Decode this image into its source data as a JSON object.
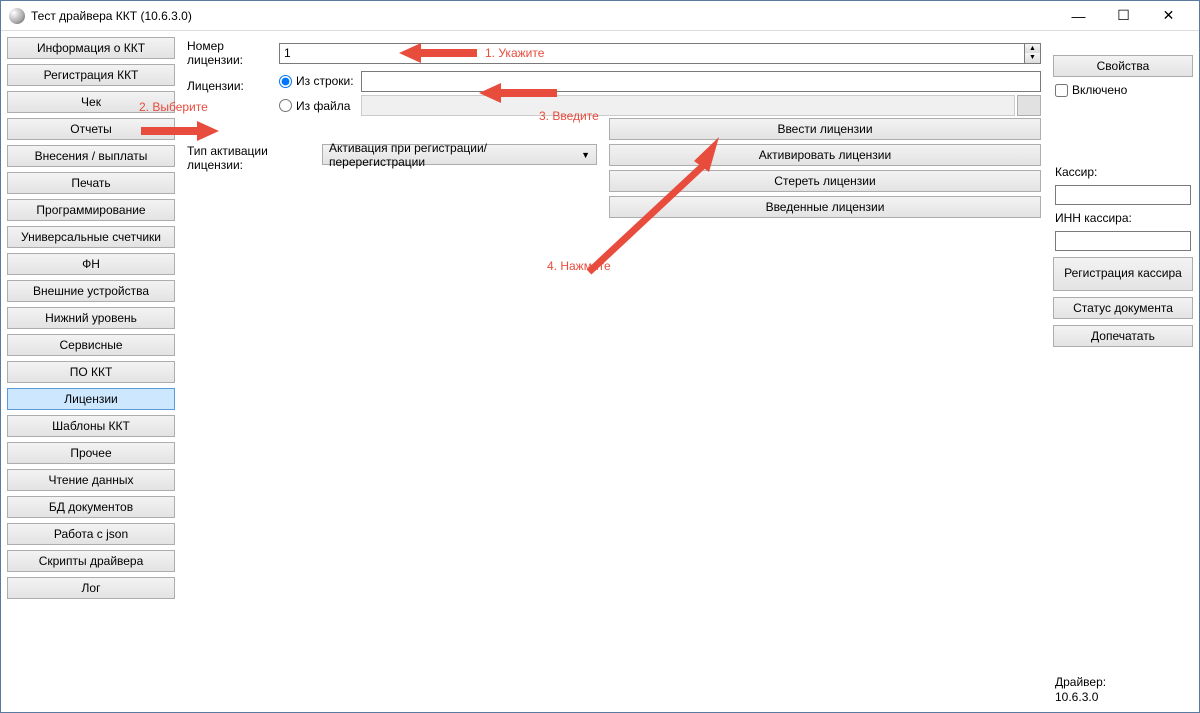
{
  "window": {
    "title": "Тест драйвера ККТ (10.6.3.0)"
  },
  "sidebar": {
    "items": [
      "Информация о ККТ",
      "Регистрация ККТ",
      "Чек",
      "Отчеты",
      "Внесения / выплаты",
      "Печать",
      "Программирование",
      "Универсальные счетчики",
      "ФН",
      "Внешние устройства",
      "Нижний уровень",
      "Сервисные",
      "ПО ККТ",
      "Лицензии",
      "Шаблоны ККТ",
      "Прочее",
      "Чтение данных",
      "БД документов",
      "Работа с json",
      "Скрипты драйвера",
      "Лог"
    ],
    "active_index": 13
  },
  "main": {
    "license_number_label": "Номер лицензии:",
    "license_number_value": "1",
    "licenses_label": "Лицензии:",
    "from_string_radio": "Из строки:",
    "from_file_radio": "Из файла",
    "string_value": "",
    "file_value": "",
    "activation_type_label": "Тип активации лицензии:",
    "activation_type_value": "Активация при регистрации/перерегистрации",
    "buttons": {
      "enter": "Ввести лицензии",
      "activate": "Активировать лицензии",
      "erase": "Стереть лицензии",
      "entered": "Введенные лицензии"
    }
  },
  "rightbar": {
    "properties": "Свойства",
    "enabled": "Включено",
    "cashier_label": "Кассир:",
    "cashier_value": "",
    "inn_label": "ИНН кассира:",
    "inn_value": "",
    "register_cashier": "Регистрация кассира",
    "doc_status": "Статус документа",
    "reprint": "Допечатать",
    "driver_label": "Драйвер:",
    "driver_version": "10.6.3.0"
  },
  "annotations": {
    "a1": "1. Укажите",
    "a2": "2. Выберите",
    "a3": "3. Введите",
    "a4": "4. Нажмите"
  }
}
